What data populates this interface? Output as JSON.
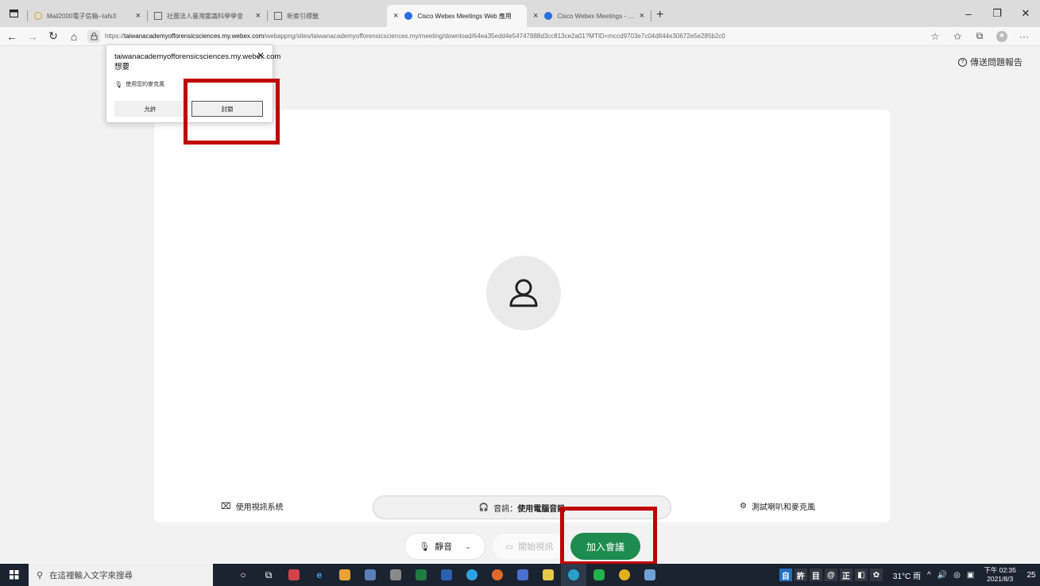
{
  "browser": {
    "tabs": [
      {
        "title": "Mail2000電子信箱--tafs3",
        "close": "×"
      },
      {
        "title": "社團法人臺灣鑑識科學學會",
        "close": "×"
      },
      {
        "title": "新索引標籤",
        "close": "×"
      },
      {
        "title": "Cisco Webex Meetings Web 應用",
        "close": "×"
      },
      {
        "title": "Cisco Webex Meetings - Meeting",
        "close": "×"
      }
    ],
    "new_tab": "+",
    "window_controls": {
      "minimize": "–",
      "maximize": "❐",
      "close": "✕"
    },
    "url_prefix": "https://",
    "url_host": "taiwanacademyofforensicsciences.my.webex.com",
    "url_path": "/webappng/sites/taiwanacademyofforensicsciences.my/meeting/download/64ea35edd4e54747888d3cc813ce2a01?MTID=mccd9703e7c04d844e30672e5e285b2c0",
    "more": "···"
  },
  "permission_popup": {
    "host": "taiwanacademyofforensicsciences.my.webex.com想要",
    "request": "使用您的麥克風",
    "allow": "允許",
    "block": "封鎖",
    "close": "✕"
  },
  "page": {
    "feedback": "傳送問題報告",
    "video_system": "使用視訊系統",
    "audio_prefix": "音訊：",
    "audio_value": "使用電腦音訊",
    "test_speaker_mic": "測試喇叭和麥克風",
    "mute": "靜音",
    "start_video": "開始視訊",
    "join": "加入會議"
  },
  "taskbar": {
    "search_placeholder": "在這裡輸入文字來搜尋",
    "ime": [
      "自",
      "許",
      "目",
      "@",
      "正",
      "◧",
      "✿"
    ],
    "weather": "31°C 雨",
    "time": "下午 02:35",
    "date": "2021/8/3",
    "notifications": "25"
  },
  "colors": {
    "accent_green": "#1d8c4e",
    "highlight_red": "#c00000"
  }
}
